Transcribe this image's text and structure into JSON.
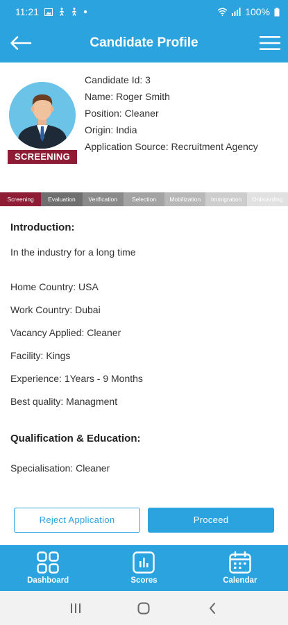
{
  "status_bar": {
    "time": "11:21",
    "battery": "100%",
    "icons": [
      "image-icon",
      "walk-icon",
      "walk-icon",
      "dot-icon",
      "wifi-icon",
      "signal-icon",
      "battery-icon"
    ]
  },
  "app_bar": {
    "title": "Candidate Profile",
    "back_icon": "arrow-left-icon",
    "menu_icon": "hamburger-menu-icon"
  },
  "profile": {
    "avatar_icon": "person-avatar-icon",
    "stage_badge": "SCREENING",
    "candidate_id": "Candidate Id: 3",
    "name": "Name: Roger Smith",
    "position": "Position: Cleaner",
    "origin": "Origin: India",
    "application_source": "Application Source: Recruitment Agency"
  },
  "stages": [
    {
      "label": "Screening",
      "active": true
    },
    {
      "label": "Evaluation",
      "active": false
    },
    {
      "label": "Verification",
      "active": false
    },
    {
      "label": "Selection",
      "active": false
    },
    {
      "label": "Mobilization",
      "active": false
    },
    {
      "label": "Immigration",
      "active": false
    },
    {
      "label": "Onboarding",
      "active": false
    }
  ],
  "introduction": {
    "heading": "Introduction:",
    "text": "In the industry for a long time"
  },
  "details": {
    "home_country": "Home Country: USA",
    "work_country": "Work Country: Dubai",
    "vacancy_applied": "Vacancy Applied: Cleaner",
    "facility": "Facility: Kings",
    "experience": "Experience: 1Years - 9 Months",
    "best_quality": "Best quality: Managment"
  },
  "qualification": {
    "heading": "Qualification & Education:",
    "specialisation": "Specialisation: Cleaner"
  },
  "actions": {
    "reject_label": "Reject Application",
    "proceed_label": "Proceed"
  },
  "bottom_nav": {
    "items": [
      {
        "label": "Dashboard",
        "icon": "grid-icon"
      },
      {
        "label": "Scores",
        "icon": "bar-chart-icon"
      },
      {
        "label": "Calendar",
        "icon": "calendar-icon"
      }
    ]
  },
  "colors": {
    "primary": "#2aa3df",
    "badge": "#8e1c34"
  }
}
